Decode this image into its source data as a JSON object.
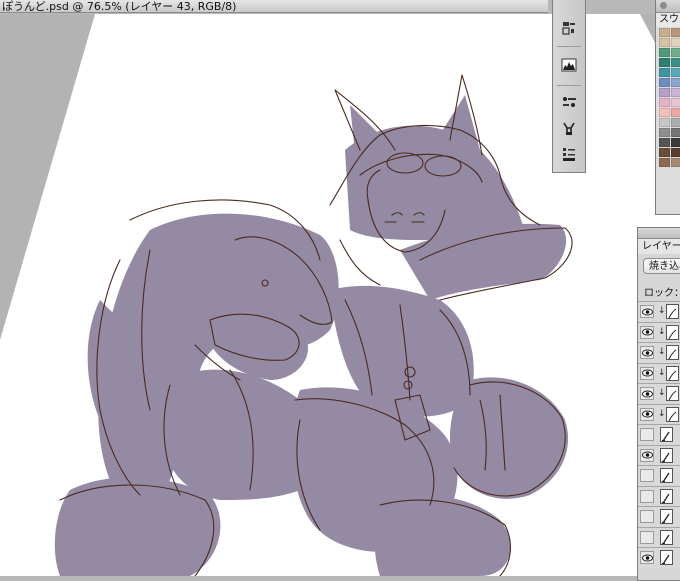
{
  "document": {
    "title": "ぽうんど.psd @ 76.5% (レイヤー 43, RGB/8)"
  },
  "tools": [
    {
      "name": "character-paragraph-icon"
    },
    {
      "name": "histogram-icon"
    },
    {
      "name": "brush-preset-icon"
    },
    {
      "name": "clone-source-icon"
    },
    {
      "name": "tool-presets-icon"
    }
  ],
  "swatches": {
    "tab_label": "スウ",
    "colors": [
      "#c9ad8d",
      "#b8977a",
      "#d6c3a5",
      "#e0d3bd",
      "#4e9a7a",
      "#6fae8d",
      "#2f8071",
      "#3c8f86",
      "#3e95a4",
      "#5aa9b8",
      "#6d8fbd",
      "#8aa3cf",
      "#b69fc9",
      "#c9b3d6",
      "#e3b4c9",
      "#eac4d3",
      "#f0c2b8",
      "#e8a9a4",
      "#c7c7c7",
      "#ababab",
      "#8f8f8f",
      "#737373",
      "#565656",
      "#3a3a3a",
      "#6a4e3a",
      "#5a3e2e",
      "#8d6d52",
      "#a58a70"
    ]
  },
  "layers_panel": {
    "tab_label": "レイヤー",
    "blend_mode": "焼き込み",
    "lock_label": "ロック：",
    "rows": [
      {
        "visible": true,
        "clipped": true,
        "thumb": "sketch"
      },
      {
        "visible": true,
        "clipped": true,
        "thumb": "sketch"
      },
      {
        "visible": true,
        "clipped": true,
        "thumb": "sketch"
      },
      {
        "visible": true,
        "clipped": true,
        "thumb": "sketch"
      },
      {
        "visible": true,
        "clipped": true,
        "thumb": "sketch"
      },
      {
        "visible": true,
        "clipped": true,
        "thumb": "sketch"
      },
      {
        "visible": false,
        "clipped": false,
        "thumb": "brush"
      },
      {
        "visible": true,
        "clipped": false,
        "thumb": "brush"
      },
      {
        "visible": false,
        "clipped": false,
        "thumb": "brush"
      },
      {
        "visible": false,
        "clipped": false,
        "thumb": "brush"
      },
      {
        "visible": false,
        "clipped": false,
        "thumb": "brush"
      },
      {
        "visible": false,
        "clipped": false,
        "thumb": "brush"
      },
      {
        "visible": true,
        "clipped": false,
        "thumb": "brush"
      }
    ]
  },
  "colors": {
    "canvas_bg": "#ffffff",
    "flat_fill": "#958aa3",
    "line_art": "#4a2a1e",
    "workspace": "#b3b3b3"
  }
}
